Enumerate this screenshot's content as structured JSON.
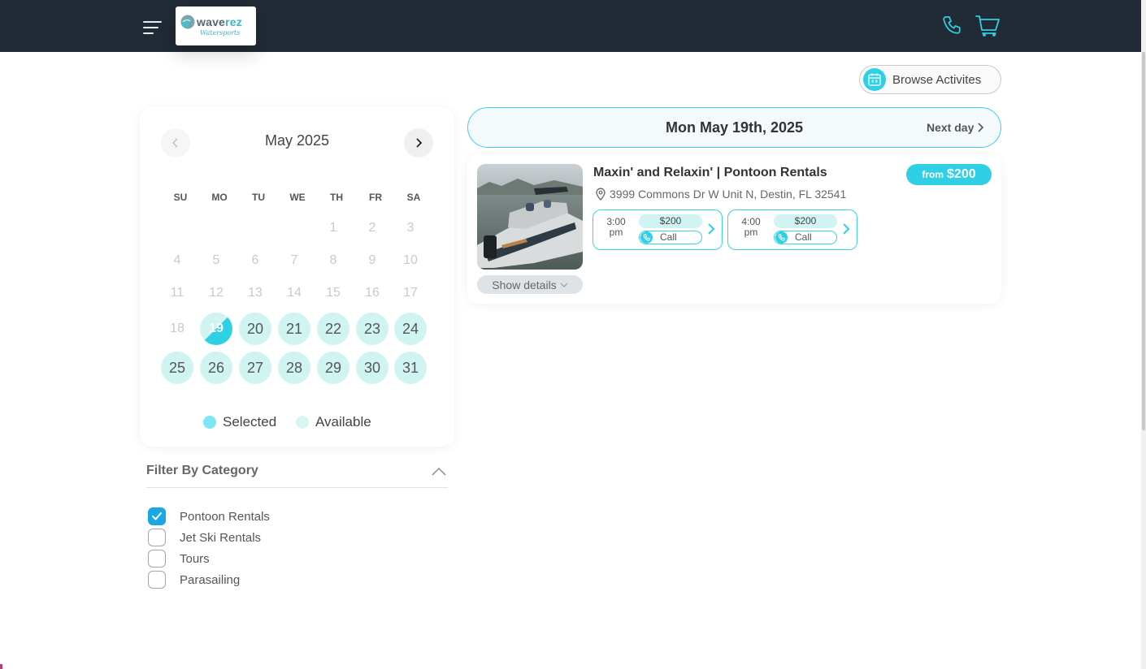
{
  "header": {
    "logo_word1": "wave",
    "logo_word2": "rez",
    "logo_sub": "Watersports",
    "icons": [
      "menu-icon",
      "phone-icon",
      "cart-icon"
    ],
    "accent": "#2fd0e6",
    "bg": "#212b35"
  },
  "browse": {
    "label": "Browse Activites"
  },
  "calendar": {
    "month": "May 2025",
    "weekdays": [
      "SU",
      "MO",
      "TU",
      "WE",
      "TH",
      "FR",
      "SA"
    ],
    "days": [
      {
        "n": "1",
        "state": "past"
      },
      {
        "n": "2",
        "state": "past"
      },
      {
        "n": "3",
        "state": "past"
      },
      {
        "n": "4",
        "state": "past"
      },
      {
        "n": "5",
        "state": "past"
      },
      {
        "n": "6",
        "state": "past"
      },
      {
        "n": "7",
        "state": "past"
      },
      {
        "n": "8",
        "state": "past"
      },
      {
        "n": "9",
        "state": "past"
      },
      {
        "n": "10",
        "state": "past"
      },
      {
        "n": "11",
        "state": "past"
      },
      {
        "n": "12",
        "state": "past"
      },
      {
        "n": "13",
        "state": "past"
      },
      {
        "n": "14",
        "state": "past"
      },
      {
        "n": "15",
        "state": "past"
      },
      {
        "n": "16",
        "state": "past"
      },
      {
        "n": "17",
        "state": "past"
      },
      {
        "n": "18",
        "state": "past"
      },
      {
        "n": "19",
        "state": "selected"
      },
      {
        "n": "20",
        "state": "available"
      },
      {
        "n": "21",
        "state": "available"
      },
      {
        "n": "22",
        "state": "available"
      },
      {
        "n": "23",
        "state": "available"
      },
      {
        "n": "24",
        "state": "available"
      },
      {
        "n": "25",
        "state": "available"
      },
      {
        "n": "26",
        "state": "available"
      },
      {
        "n": "27",
        "state": "available"
      },
      {
        "n": "28",
        "state": "available"
      },
      {
        "n": "29",
        "state": "available"
      },
      {
        "n": "30",
        "state": "available"
      },
      {
        "n": "31",
        "state": "available"
      }
    ],
    "first_weekday": 4,
    "legend_selected": "Selected",
    "legend_available": "Available",
    "selected_color": "#7ee6f3",
    "available_color": "#d9f6f4"
  },
  "filter": {
    "title": "Filter By Category",
    "categories": [
      {
        "label": "Pontoon Rentals",
        "checked": true
      },
      {
        "label": "Jet Ski Rentals",
        "checked": false
      },
      {
        "label": "Tours",
        "checked": false
      },
      {
        "label": "Parasailing",
        "checked": false
      }
    ]
  },
  "datebar": {
    "date": "Mon May 19th, 2025",
    "next": "Next day"
  },
  "activity": {
    "title": "Maxin' and Relaxin' | Pontoon Rentals",
    "from_label": "from",
    "price": "$200",
    "address": "3999 Commons Dr W Unit N, Destin, FL 32541",
    "show_details": "Show details",
    "slots": [
      {
        "time_top": "3:00",
        "time_bottom": "pm",
        "price": "$200",
        "action": "Call"
      },
      {
        "time_top": "4:00",
        "time_bottom": "pm",
        "price": "$200",
        "action": "Call"
      }
    ]
  }
}
